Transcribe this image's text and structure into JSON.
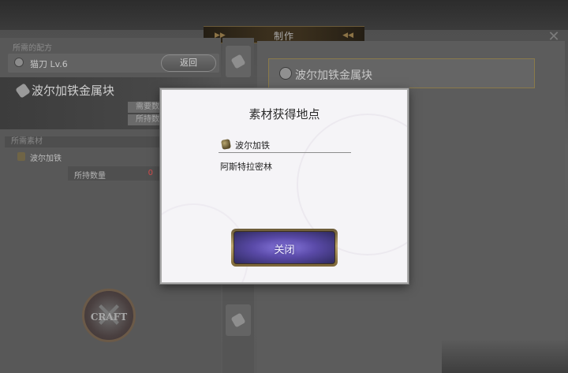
{
  "top_bar": {
    "title": "制作"
  },
  "left_panel": {
    "section_label": "所需的配方",
    "weapon_name": "猫刀 Lv.6",
    "back_label": "返回",
    "item_name": "波尔加铁金属块",
    "required_label": "需要数",
    "owned_label": "所持数",
    "materials_header": "所需素材",
    "material_name": "波尔加铁",
    "owned_count_label": "所持数量",
    "owned_count_value": "0",
    "craft_emblem_text": "CRAFT"
  },
  "right_panel": {
    "item_name": "波尔加铁金属块"
  },
  "modal": {
    "title": "素材获得地点",
    "material_name": "波尔加铁",
    "location": "阿斯特拉密林",
    "close_label": "关闭"
  }
}
